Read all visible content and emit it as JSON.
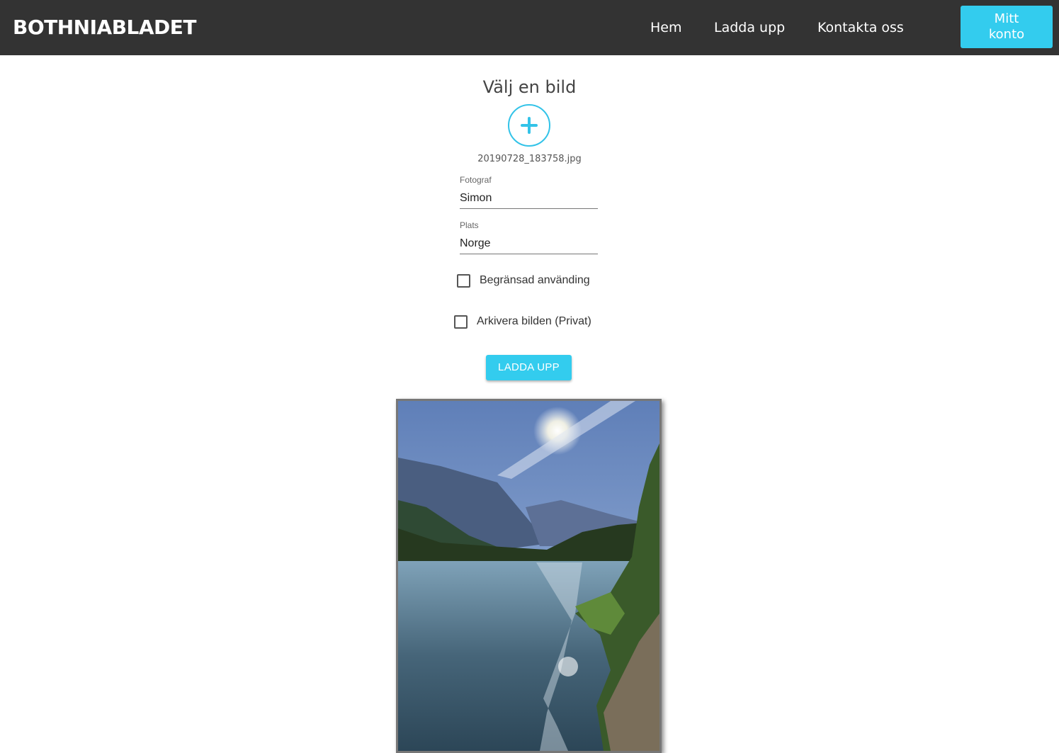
{
  "navbar": {
    "brand": "BOTHNIABLADET",
    "links": [
      "Hem",
      "Ladda upp",
      "Kontakta oss"
    ],
    "account_button": "Mitt konto",
    "background": "#333333",
    "accent": "#33ccee"
  },
  "form": {
    "title": "Välj en bild",
    "add_icon": "plus-circle-icon",
    "filename": "20190728_183758.jpg",
    "photographer_label": "Fotograf",
    "photographer_value": "Simon",
    "location_label": "Plats",
    "location_value": "Norge",
    "restricted_label": "Begränsad använding",
    "restricted_checked": false,
    "archive_label": "Arkivera bilden (Privat)",
    "archive_checked": false,
    "submit_label": "LADDA UPP"
  },
  "preview": {
    "description_icon": "image-preview"
  }
}
